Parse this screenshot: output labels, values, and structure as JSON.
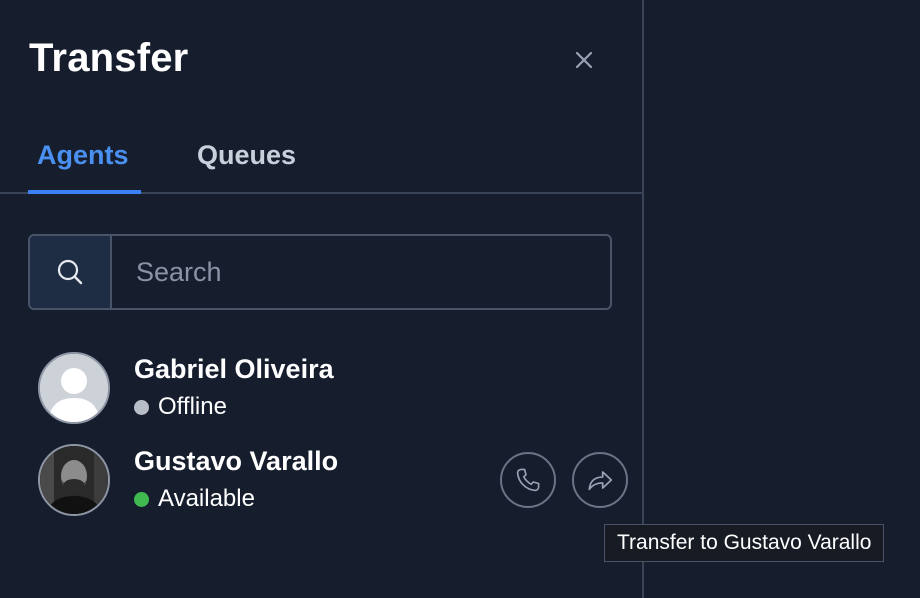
{
  "panel": {
    "title": "Transfer",
    "close_icon": "close-icon"
  },
  "tabs": [
    {
      "label": "Agents",
      "active": true
    },
    {
      "label": "Queues",
      "active": false
    }
  ],
  "search": {
    "placeholder": "Search",
    "value": "",
    "icon": "search-icon"
  },
  "agents": [
    {
      "name": "Gabriel Oliveira",
      "status": "Offline",
      "status_color": "#b8bdc7",
      "avatar": "default-avatar"
    },
    {
      "name": "Gustavo Varallo",
      "status": "Available",
      "status_color": "#3fb950",
      "avatar": "photo-avatar"
    }
  ],
  "actions": {
    "call_icon": "phone-icon",
    "transfer_icon": "forward-arrow-icon"
  },
  "tooltip": {
    "text": "Transfer to Gustavo Varallo"
  },
  "colors": {
    "background": "#161e2e",
    "accent": "#3b82f6",
    "divider": "#3a4459"
  }
}
